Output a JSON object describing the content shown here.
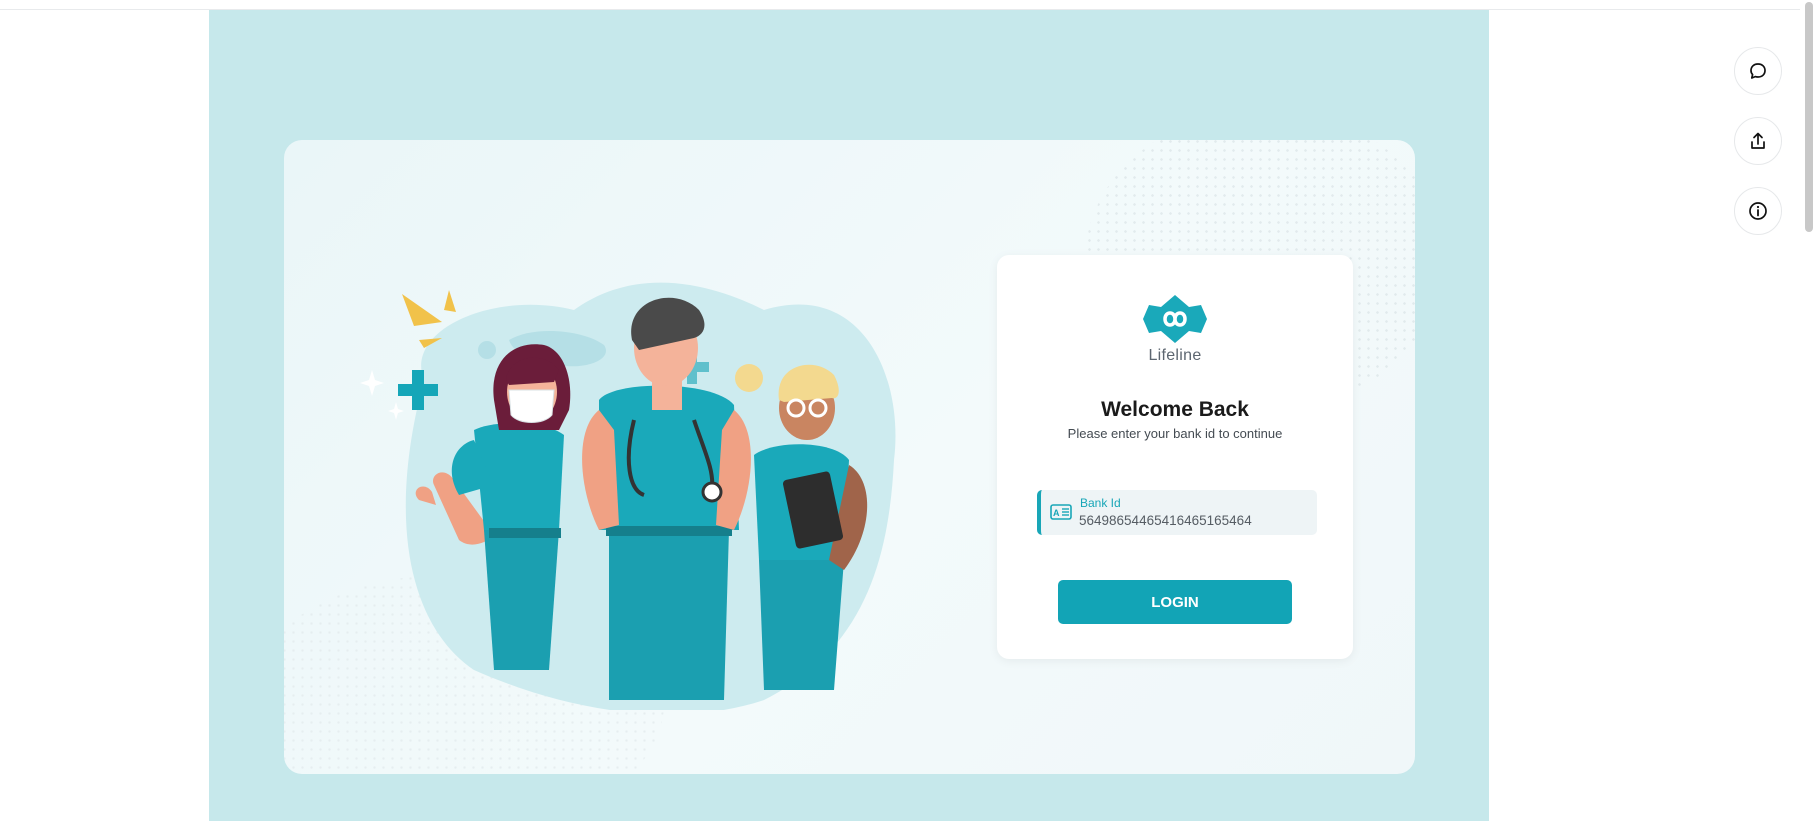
{
  "brand": {
    "name": "Lifeline",
    "accent_color": "#12a4b6"
  },
  "login": {
    "title": "Welcome Back",
    "subtitle": "Please enter your bank id to continue",
    "bank_id_label": "Bank Id",
    "bank_id_value": "5649865446541646516546‌4",
    "login_button": "LOGIN"
  },
  "side_actions": [
    {
      "icon": "chat-bubble-icon"
    },
    {
      "icon": "share-upload-icon"
    },
    {
      "icon": "info-icon"
    }
  ]
}
